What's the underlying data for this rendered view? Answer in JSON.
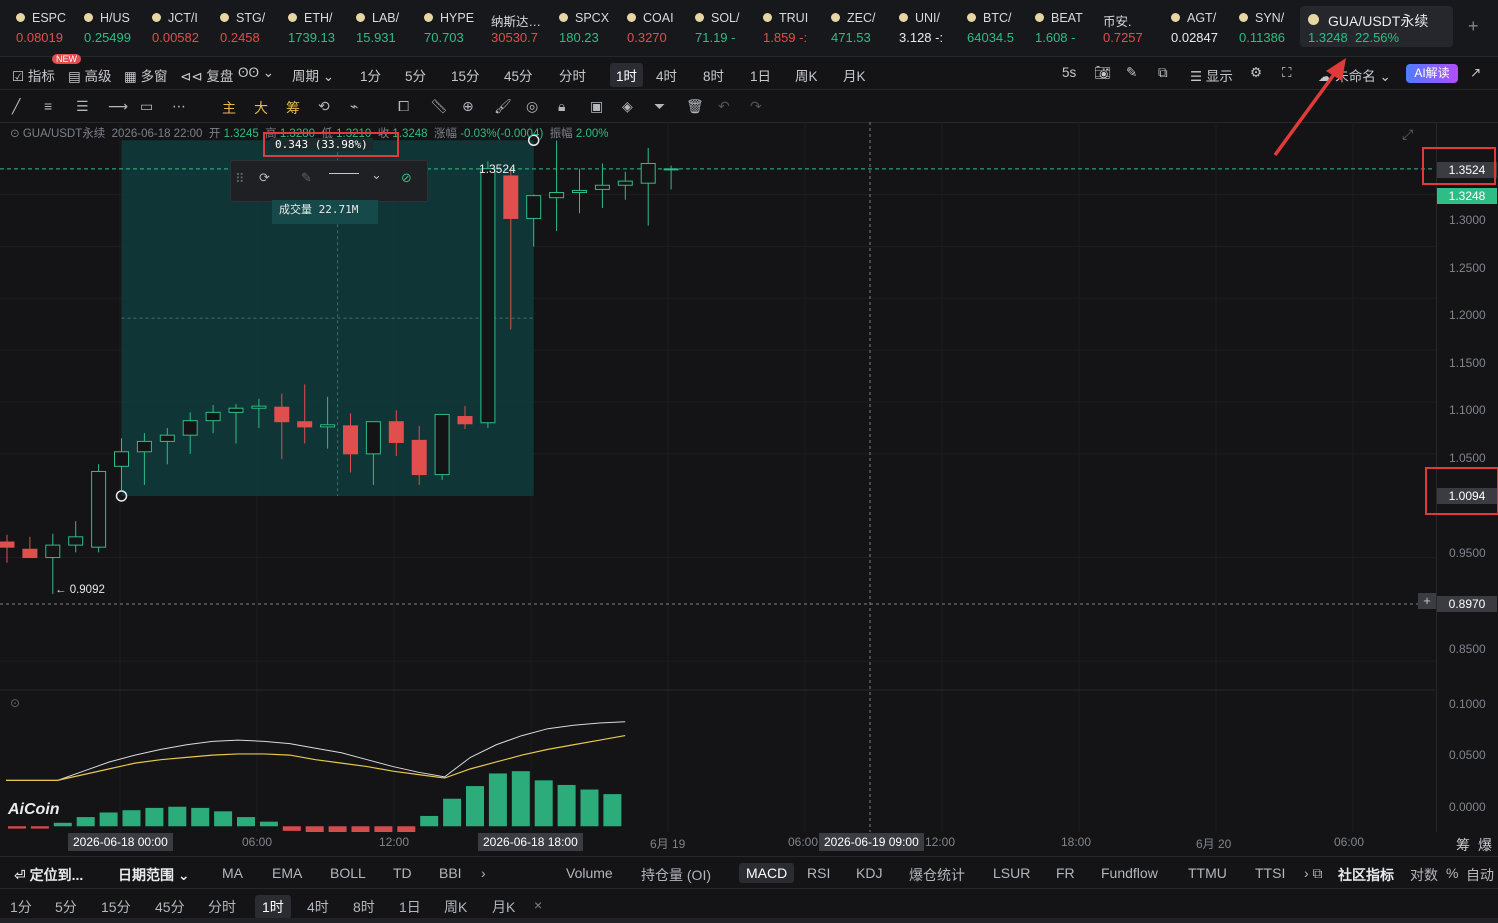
{
  "tickers": [
    {
      "symbol": "ESPC",
      "price": "0.08019",
      "dir": "dn"
    },
    {
      "symbol": "H/US",
      "price": "0.25499",
      "dir": "up"
    },
    {
      "symbol": "JCT/I",
      "price": "0.00582",
      "dir": "dn"
    },
    {
      "symbol": "STG/",
      "price": "0.2458",
      "dir": "dn"
    },
    {
      "symbol": "ETH/",
      "price": "1739.13",
      "dir": "up"
    },
    {
      "symbol": "LAB/",
      "price": "15.931",
      "dir": "up"
    },
    {
      "symbol": "HYPE",
      "price": "70.703",
      "dir": "up"
    },
    {
      "symbol": "纳斯达…",
      "price": "30530.7",
      "dir": "dn"
    },
    {
      "symbol": "SPCX",
      "price": "180.23",
      "dir": "up"
    },
    {
      "symbol": "COAI",
      "price": "0.3270",
      "dir": "dn"
    },
    {
      "symbol": "SOL/",
      "price": "71.19 -",
      "dir": "up"
    },
    {
      "symbol": "TRUI",
      "price": "1.859 -:",
      "dir": "dn"
    },
    {
      "symbol": "ZEC/",
      "price": "471.53",
      "dir": "up"
    },
    {
      "symbol": "UNI/",
      "price": "3.128 -:",
      "dir": "wt"
    },
    {
      "symbol": "BTC/",
      "price": "64034.5",
      "dir": "up"
    },
    {
      "symbol": "BEAT",
      "price": "1.608 -",
      "dir": "up"
    },
    {
      "symbol": "币安.",
      "price": "0.7257",
      "dir": "dn"
    },
    {
      "symbol": "AGT/",
      "price": "0.02847",
      "dir": "wt"
    },
    {
      "symbol": "SYN/",
      "price": "0.11386",
      "dir": "up"
    }
  ],
  "active_ticker": {
    "symbol": "GUA/USDT永续",
    "price": "1.3248",
    "change": "22.56%"
  },
  "toolbar": {
    "indicator": "指标",
    "new_badge": "NEW",
    "advanced": "高级",
    "multi_window": "多窗",
    "replay": "复盘",
    "period": "周期",
    "intervals": [
      "1分",
      "5分",
      "15分",
      "45分",
      "分时",
      "1时",
      "4时",
      "8时",
      "1日",
      "周K",
      "月K"
    ],
    "selected_interval": "1时",
    "refresh": "5s",
    "display": "显示",
    "rename": "未命名",
    "ai": "AI解读"
  },
  "drawing_tools": {
    "main": "主",
    "big": "大",
    "chips": "筹"
  },
  "info": {
    "pair": "GUA/USDT永续",
    "datetime": "2026-06-18 22:00",
    "open_label": "开",
    "open": "1.3245",
    "high_label": "高",
    "high": "1.3280",
    "low_label": "低",
    "low": "1.3210",
    "close_label": "收",
    "close": "1.3248",
    "chg_label": "涨幅",
    "chg": "-0.03%(-0.0004)",
    "amp_label": "振幅",
    "amp": "2.00%"
  },
  "measure": {
    "text": "0.343 (33.98%)",
    "volume": "成交量 22.71M",
    "top_price": "1.3524",
    "low_price": "← 0.9092"
  },
  "price_axis": {
    "ticks": [
      "1.3000",
      "1.2500",
      "1.2000",
      "1.1500",
      "1.1000",
      "1.0500",
      "0.9500",
      "0.8500",
      "0.1000",
      "0.0500",
      "0.0000"
    ],
    "tag_high": "1.3524",
    "tag_last": "1.3248",
    "tag_low": "1.0094",
    "tag_cross": "0.8970"
  },
  "time_axis": {
    "labels": [
      "06:00",
      "12:00",
      "6月 19",
      "06:00",
      "12:00",
      "18:00",
      "6月 20",
      "06:00"
    ],
    "hl_start": "2026-06-18 00:00",
    "hl_end": "2026-06-18 18:00",
    "hl_cross": "2026-06-19 09:00"
  },
  "bottom_indicators": {
    "locate": "定位到...",
    "date_range": "日期范围",
    "items": [
      "MA",
      "EMA",
      "BOLL",
      "TD",
      "BBI",
      "Volume",
      "持仓量 (OI)",
      "MACD",
      "RSI",
      "KDJ",
      "爆仓统计",
      "LSUR",
      "FR",
      "Fundflow",
      "TTMU",
      "TTSI"
    ],
    "selected": "MACD",
    "community": "社区指标",
    "log": "对数",
    "pct": "%",
    "auto": "自动",
    "chip": "筹",
    "burst": "爆"
  },
  "bottom_intervals": [
    "1分",
    "5分",
    "15分",
    "45分",
    "分时",
    "1时",
    "4时",
    "8时",
    "1日",
    "周K",
    "月K"
  ],
  "watermark": "AiCoin",
  "chart_data": {
    "type": "candlestick",
    "interval": "1h",
    "candles": [
      {
        "o": 0.965,
        "h": 0.972,
        "l": 0.945,
        "c": 0.96
      },
      {
        "o": 0.958,
        "h": 0.97,
        "l": 0.95,
        "c": 0.95
      },
      {
        "o": 0.95,
        "h": 0.973,
        "l": 0.915,
        "c": 0.962
      },
      {
        "o": 0.962,
        "h": 0.985,
        "l": 0.955,
        "c": 0.97
      },
      {
        "o": 0.96,
        "h": 1.04,
        "l": 0.955,
        "c": 1.033
      },
      {
        "o": 1.038,
        "h": 1.065,
        "l": 1.015,
        "c": 1.052
      },
      {
        "o": 1.052,
        "h": 1.07,
        "l": 1.02,
        "c": 1.062
      },
      {
        "o": 1.062,
        "h": 1.075,
        "l": 1.04,
        "c": 1.068
      },
      {
        "o": 1.068,
        "h": 1.09,
        "l": 1.05,
        "c": 1.082
      },
      {
        "o": 1.082,
        "h": 1.097,
        "l": 1.07,
        "c": 1.09
      },
      {
        "o": 1.09,
        "h": 1.098,
        "l": 1.06,
        "c": 1.094
      },
      {
        "o": 1.094,
        "h": 1.103,
        "l": 1.075,
        "c": 1.096
      },
      {
        "o": 1.095,
        "h": 1.108,
        "l": 1.045,
        "c": 1.081
      },
      {
        "o": 1.081,
        "h": 1.117,
        "l": 1.06,
        "c": 1.076
      },
      {
        "o": 1.076,
        "h": 1.105,
        "l": 1.055,
        "c": 1.078
      },
      {
        "o": 1.077,
        "h": 1.089,
        "l": 1.032,
        "c": 1.05
      },
      {
        "o": 1.05,
        "h": 1.08,
        "l": 1.02,
        "c": 1.081
      },
      {
        "o": 1.081,
        "h": 1.092,
        "l": 1.048,
        "c": 1.061
      },
      {
        "o": 1.063,
        "h": 1.077,
        "l": 1.02,
        "c": 1.03
      },
      {
        "o": 1.03,
        "h": 1.088,
        "l": 1.025,
        "c": 1.088
      },
      {
        "o": 1.086,
        "h": 1.096,
        "l": 1.074,
        "c": 1.079
      },
      {
        "o": 1.08,
        "h": 1.332,
        "l": 1.075,
        "c": 1.325
      },
      {
        "o": 1.318,
        "h": 1.325,
        "l": 1.17,
        "c": 1.277
      },
      {
        "o": 1.277,
        "h": 1.3,
        "l": 1.25,
        "c": 1.299
      },
      {
        "o": 1.297,
        "h": 1.352,
        "l": 1.265,
        "c": 1.302
      },
      {
        "o": 1.302,
        "h": 1.325,
        "l": 1.282,
        "c": 1.304
      },
      {
        "o": 1.305,
        "h": 1.33,
        "l": 1.287,
        "c": 1.309
      },
      {
        "o": 1.309,
        "h": 1.322,
        "l": 1.295,
        "c": 1.313
      },
      {
        "o": 1.311,
        "h": 1.345,
        "l": 1.27,
        "c": 1.33
      },
      {
        "o": 1.3245,
        "h": 1.328,
        "l": 1.305,
        "c": 1.3248
      }
    ],
    "price_range": [
      0.83,
      1.37
    ],
    "macd_hist": [
      -0.002,
      -0.002,
      0.003,
      0.008,
      0.012,
      0.014,
      0.016,
      0.017,
      0.016,
      0.013,
      0.008,
      0.004,
      -0.004,
      -0.007,
      -0.01,
      -0.016,
      -0.018,
      -0.015,
      0.009,
      0.024,
      0.035,
      0.046,
      0.048,
      0.04,
      0.036,
      0.032,
      0.028
    ],
    "dif": [
      0.04,
      0.04,
      0.04,
      0.048,
      0.056,
      0.062,
      0.067,
      0.071,
      0.074,
      0.075,
      0.074,
      0.072,
      0.068,
      0.064,
      0.058,
      0.052,
      0.047,
      0.043,
      0.06,
      0.071,
      0.079,
      0.085,
      0.088,
      0.09,
      0.091
    ],
    "dea": [
      0.04,
      0.04,
      0.04,
      0.045,
      0.05,
      0.055,
      0.058,
      0.06,
      0.062,
      0.063,
      0.063,
      0.062,
      0.058,
      0.055,
      0.052,
      0.048,
      0.045,
      0.042,
      0.05,
      0.056,
      0.062,
      0.067,
      0.071,
      0.075,
      0.079
    ],
    "macd_range": [
      -0.005,
      0.11
    ]
  }
}
